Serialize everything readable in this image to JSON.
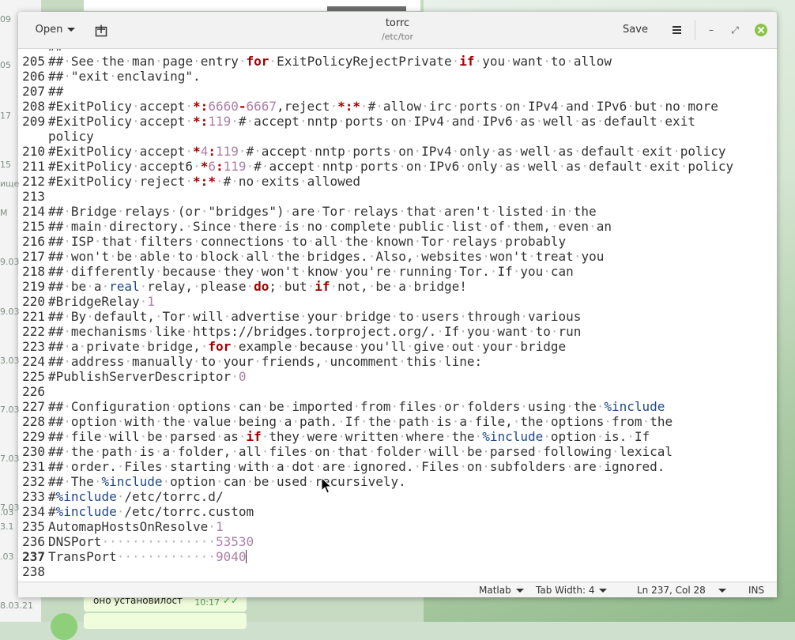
{
  "window": {
    "title": "torrc",
    "path": "/etc/tor",
    "open_label": "Open",
    "save_label": "Save"
  },
  "background": {
    "left_labels": [
      "09",
      "05",
      "17",
      "15",
      "ище",
      "M",
      "9.03",
      "9.03",
      "3.03",
      "7.03",
      "7.03",
      "7.03",
      ".03",
      "3.1",
      ".03",
      "8.03.21"
    ],
    "chat_message": "оно установилост",
    "chat_time": "10:17"
  },
  "status": {
    "language": "Matlab",
    "tab_width": "Tab Width: 4",
    "position": "Ln 237, Col 28",
    "mode": "INS"
  },
  "lines": [
    {
      "n": "205",
      "t": "## See the man page entry for ExitPolicyRejectPrivate if you want to allow"
    },
    {
      "n": "206",
      "t": "## \"exit enclaving\"."
    },
    {
      "n": "207",
      "t": "##"
    },
    {
      "n": "208",
      "t": "#ExitPolicy accept *:6660-6667,reject *:* # allow irc ports on IPv4 and IPv6 but no more"
    },
    {
      "n": "209",
      "t": "#ExitPolicy accept *:119 # accept nntp ports on IPv4 and IPv6 as well as default exit"
    },
    {
      "n": "",
      "t": "policy"
    },
    {
      "n": "210",
      "t": "#ExitPolicy accept *4:119 # accept nntp ports on IPv4 only as well as default exit policy"
    },
    {
      "n": "211",
      "t": "#ExitPolicy accept6 *6:119 # accept nntp ports on IPv6 only as well as default exit policy"
    },
    {
      "n": "212",
      "t": "#ExitPolicy reject *:* # no exits allowed"
    },
    {
      "n": "213",
      "t": ""
    },
    {
      "n": "214",
      "t": "## Bridge relays (or \"bridges\") are Tor relays that aren't listed in the"
    },
    {
      "n": "215",
      "t": "## main directory. Since there is no complete public list of them, even an"
    },
    {
      "n": "216",
      "t": "## ISP that filters connections to all the known Tor relays probably"
    },
    {
      "n": "217",
      "t": "## won't be able to block all the bridges. Also, websites won't treat you"
    },
    {
      "n": "218",
      "t": "## differently because they won't know you're running Tor. If you can"
    },
    {
      "n": "219",
      "t": "## be a real relay, please do; but if not, be a bridge!"
    },
    {
      "n": "220",
      "t": "#BridgeRelay 1"
    },
    {
      "n": "221",
      "t": "## By default, Tor will advertise your bridge to users through various"
    },
    {
      "n": "222",
      "t": "## mechanisms like https://bridges.torproject.org/. If you want to run"
    },
    {
      "n": "223",
      "t": "## a private bridge, for example because you'll give out your bridge"
    },
    {
      "n": "224",
      "t": "## address manually to your friends, uncomment this line:"
    },
    {
      "n": "225",
      "t": "#PublishServerDescriptor 0"
    },
    {
      "n": "226",
      "t": ""
    },
    {
      "n": "227",
      "t": "## Configuration options can be imported from files or folders using the %include"
    },
    {
      "n": "228",
      "t": "## option with the value being a path. If the path is a file, the options from the"
    },
    {
      "n": "229",
      "t": "## file will be parsed as if they were written where the %include option is. If"
    },
    {
      "n": "230",
      "t": "## the path is a folder, all files on that folder will be parsed following lexical"
    },
    {
      "n": "231",
      "t": "## order. Files starting with a dot are ignored. Files on subfolders are ignored."
    },
    {
      "n": "232",
      "t": "## The %include option can be used recursively."
    },
    {
      "n": "233",
      "t": "#%include /etc/torrc.d/"
    },
    {
      "n": "234",
      "t": "#%include /etc/torrc.custom"
    },
    {
      "n": "235",
      "t": "AutomapHostsOnResolve 1"
    },
    {
      "n": "236",
      "t": "DNSPort               53530"
    },
    {
      "n": "237",
      "t": "TransPort             9040"
    },
    {
      "n": "238",
      "t": ""
    }
  ]
}
